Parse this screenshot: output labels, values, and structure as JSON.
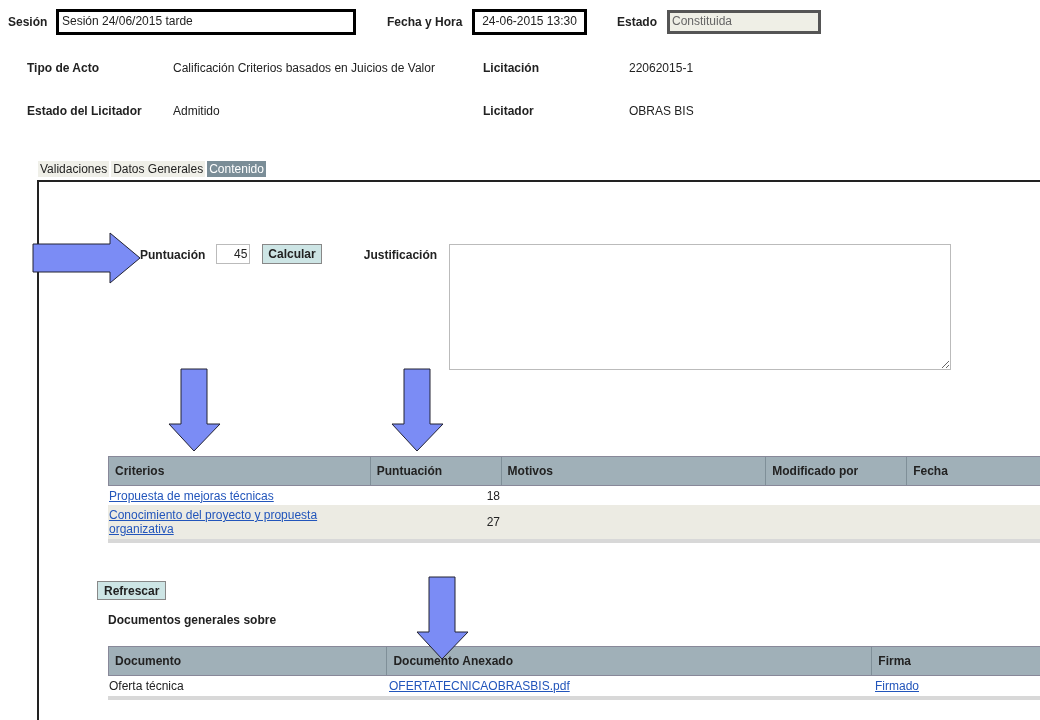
{
  "header": {
    "sesion": {
      "label": "Sesión",
      "value": "Sesión 24/06/2015 tarde"
    },
    "fecha": {
      "label": "Fecha y Hora",
      "value": "24-06-2015 13:30"
    },
    "estado": {
      "label": "Estado",
      "value": "Constituida"
    }
  },
  "info": [
    {
      "label": "Tipo de Acto",
      "value": "Calificación Criterios basados en Juicios de Valor"
    },
    {
      "label": "Licitación",
      "value": "22062015-1"
    },
    {
      "label": "Estado del Licitador",
      "value": "Admitido"
    },
    {
      "label": "Licitador",
      "value": "OBRAS BIS"
    }
  ],
  "tabs": [
    {
      "label": "Validaciones",
      "selected": false
    },
    {
      "label": "Datos Generales",
      "selected": false
    },
    {
      "label": "Contenido",
      "selected": true
    }
  ],
  "puntuacion": {
    "label": "Puntuación",
    "value": "45",
    "button": "Calcular"
  },
  "justificacion": {
    "label": "Justificación"
  },
  "criterios_table": {
    "columns": [
      "Criterios",
      "Puntuación",
      "Motivos",
      "Modificado por",
      "Fecha"
    ],
    "rows": [
      {
        "criterio": "Propuesta de mejoras técnicas",
        "puntuacion": "18"
      },
      {
        "criterio": "Conocimiento del proyecto y propuesta organizativa",
        "puntuacion": "27"
      }
    ]
  },
  "refresh_button": "Refrescar",
  "documents_title": "Documentos generales sobre",
  "documents_table": {
    "columns": [
      "Documento",
      "Documento Anexado",
      "Firma"
    ],
    "rows": [
      {
        "documento": "Oferta técnica",
        "anexo": "OFERTATECNICAOBRASBIS.pdf",
        "firma": "Firmado"
      }
    ]
  },
  "arrows": [
    {
      "kind": "right"
    },
    {
      "kind": "down"
    },
    {
      "kind": "down"
    },
    {
      "kind": "down"
    }
  ]
}
